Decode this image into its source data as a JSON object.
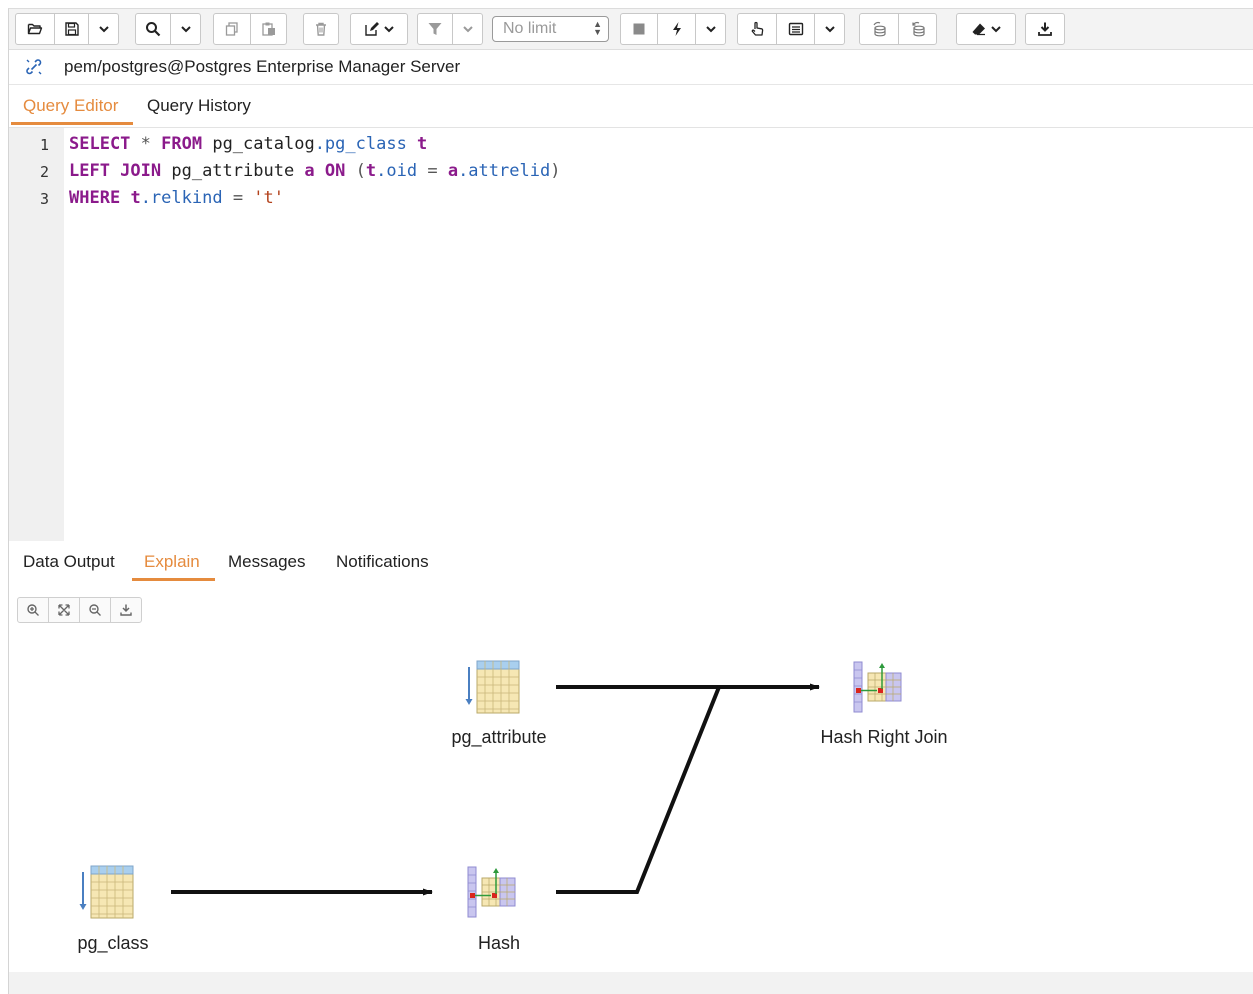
{
  "toolbar": {
    "limit_value": "No limit"
  },
  "connection": {
    "title": "pem/postgres@Postgres Enterprise Manager Server"
  },
  "editor_tabs": [
    {
      "label": "Query Editor",
      "active": true
    },
    {
      "label": "Query History",
      "active": false
    }
  ],
  "editor": {
    "line_numbers": [
      "1",
      "2",
      "3"
    ],
    "lines": [
      [
        {
          "t": "SELECT",
          "c": "kw"
        },
        {
          "t": " * ",
          "c": "op"
        },
        {
          "t": "FROM",
          "c": "kw"
        },
        {
          "t": " pg_catalog",
          "c": "id"
        },
        {
          "t": ".pg_class",
          "c": "fn"
        },
        {
          "t": " t",
          "c": "kw"
        }
      ],
      [
        {
          "t": "LEFT JOIN",
          "c": "kw"
        },
        {
          "t": " pg_attribute ",
          "c": "id"
        },
        {
          "t": "a",
          "c": "kw"
        },
        {
          "t": " ",
          "c": "id"
        },
        {
          "t": "ON",
          "c": "kw"
        },
        {
          "t": " (",
          "c": "op"
        },
        {
          "t": "t",
          "c": "kw"
        },
        {
          "t": ".oid",
          "c": "fn"
        },
        {
          "t": " = ",
          "c": "op"
        },
        {
          "t": "a",
          "c": "kw"
        },
        {
          "t": ".attrelid",
          "c": "fn"
        },
        {
          "t": ")",
          "c": "op"
        }
      ],
      [
        {
          "t": "WHERE",
          "c": "kw"
        },
        {
          "t": " ",
          "c": "id"
        },
        {
          "t": "t",
          "c": "kw"
        },
        {
          "t": ".relkind",
          "c": "fn"
        },
        {
          "t": " = ",
          "c": "op"
        },
        {
          "t": "'t'",
          "c": "str"
        }
      ]
    ]
  },
  "result_tabs": [
    {
      "label": "Data Output",
      "active": false
    },
    {
      "label": "Explain",
      "active": true
    },
    {
      "label": "Messages",
      "active": false
    },
    {
      "label": "Notifications",
      "active": false
    }
  ],
  "explain_plan": {
    "nodes": [
      {
        "id": "pg_attribute",
        "label": "pg_attribute",
        "icon": "seq-scan-icon"
      },
      {
        "id": "hash_right_join",
        "label": "Hash Right Join",
        "icon": "hash-join-icon"
      },
      {
        "id": "pg_class",
        "label": "pg_class",
        "icon": "seq-scan-icon"
      },
      {
        "id": "hash",
        "label": "Hash",
        "icon": "hash-icon"
      }
    ],
    "edges": [
      {
        "from": "pg_attribute",
        "to": "hash_right_join"
      },
      {
        "from": "pg_class",
        "to": "hash"
      },
      {
        "from": "hash",
        "to": "hash_right_join"
      }
    ]
  },
  "colors": {
    "accent": "#e58b3e",
    "keyword": "#8b1a8b",
    "identifier_blue": "#2a64b5",
    "string": "#b3421c"
  }
}
